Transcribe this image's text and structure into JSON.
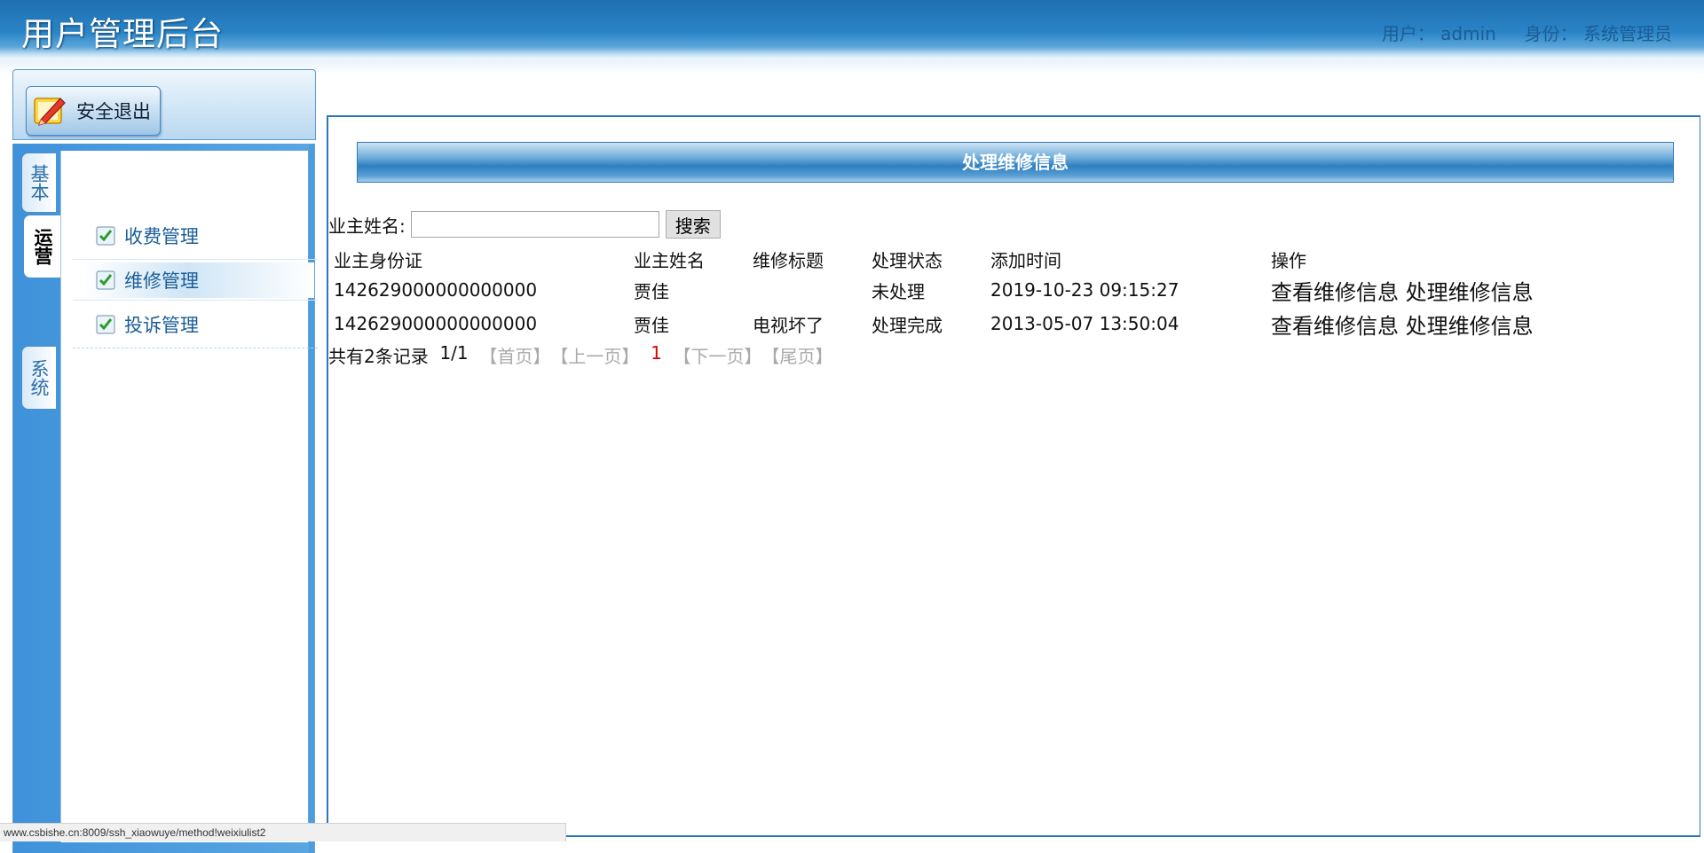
{
  "header": {
    "title": "用户管理后台",
    "user_label": "用户：",
    "user_name": "admin",
    "role_label": "身份：",
    "role_name": "系统管理员"
  },
  "sidebar": {
    "logout_label": "安全退出",
    "tabs": [
      {
        "label": "基本",
        "active": false
      },
      {
        "label": "运营",
        "active": true
      },
      {
        "label": "系统",
        "active": false
      }
    ],
    "menu": [
      {
        "label": "收费管理",
        "active": false
      },
      {
        "label": "维修管理",
        "active": true
      },
      {
        "label": "投诉管理",
        "active": false
      }
    ]
  },
  "main": {
    "panel_title": "处理维修信息",
    "search": {
      "label": "业主姓名:",
      "value": "",
      "button_label": "搜索"
    },
    "table": {
      "headers": [
        "业主身份证",
        "业主姓名",
        "维修标题",
        "处理状态",
        "添加时间",
        "操作"
      ],
      "rows": [
        {
          "id_card": "142629000000000000",
          "owner_name": "贾佳",
          "repair_title": "",
          "status": "未处理",
          "added_time": "2019-10-23 09:15:27",
          "view_label": "查看维修信息",
          "process_label": "处理维修信息"
        },
        {
          "id_card": "142629000000000000",
          "owner_name": "贾佳",
          "repair_title": "电视坏了",
          "status": "处理完成",
          "added_time": "2013-05-07 13:50:04",
          "view_label": "查看维修信息",
          "process_label": "处理维修信息"
        }
      ]
    },
    "pager": {
      "total_text": "共有2条记录",
      "page_info": "1/1",
      "first": "【首页】",
      "prev": "【上一页】",
      "current": "1",
      "next": "【下一页】",
      "last": "【尾页】"
    }
  },
  "status_bar": {
    "url": "www.csbishe.cn:8009/ssh_xiaowuye/method!weixiulist2"
  },
  "colors": {
    "header_blue": "#1f6fb1",
    "border_blue": "#2b77b7",
    "link_blue": "#1b5d98",
    "current_page_red": "#dd0000"
  }
}
